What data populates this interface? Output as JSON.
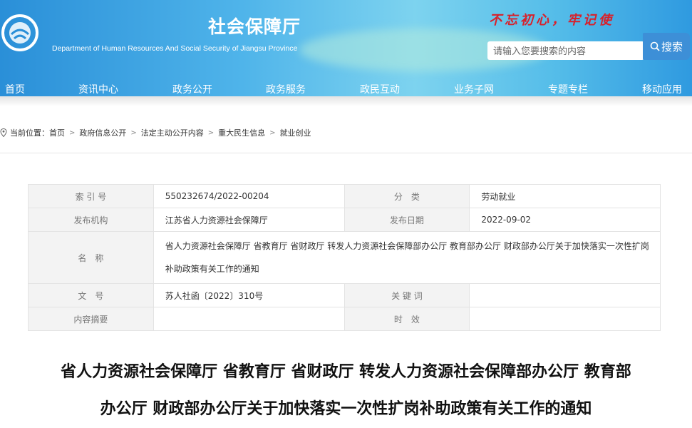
{
  "header": {
    "title_cn": "社会保障厅",
    "title_en": "Department of Human Resources And Social Security of Jiangsu Province",
    "slogan": "不忘初心，牢记使",
    "search_placeholder": "请输入您要搜索的内容",
    "search_button": "搜索"
  },
  "nav": {
    "items": [
      "首页",
      "资讯中心",
      "政务公开",
      "政务服务",
      "政民互动",
      "业务子网",
      "专题专栏",
      "移动应用"
    ]
  },
  "breadcrumb": {
    "prefix": "当前位置：",
    "items": [
      "首页",
      "政府信息公开",
      "法定主动公开内容",
      "重大民生信息",
      "就业创业"
    ],
    "separator": ">"
  },
  "meta": {
    "index_label": "索 引 号",
    "index_value": "550232674/2022-00204",
    "category_label": "分　类",
    "category_value": "劳动就业",
    "publisher_label": "发布机构",
    "publisher_value": "江苏省人力资源社会保障厅",
    "date_label": "发布日期",
    "date_value": "2022-09-02",
    "name_label": "名　称",
    "name_value_line1": "省人力资源社会保障厅 省教育厅 省财政厅 转发人力资源社会保障部办公厅 教育部办公厅 财政部办公厅关于加快落实一次性扩岗",
    "name_value_line2": "补助政策有关工作的通知",
    "docno_label": "文　号",
    "docno_value": "苏人社函〔2022〕310号",
    "keywords_label": "关 键 词",
    "keywords_value": "",
    "summary_label": "内容摘要",
    "summary_value": "",
    "validity_label": "时　效",
    "validity_value": ""
  },
  "document": {
    "title_line1": "省人力资源社会保障厅 省教育厅 省财政厅 转发人力资源社会保障部办公厅 教育部",
    "title_line2": "办公厅 财政部办公厅关于加快落实一次性扩岗补助政策有关工作的通知"
  }
}
